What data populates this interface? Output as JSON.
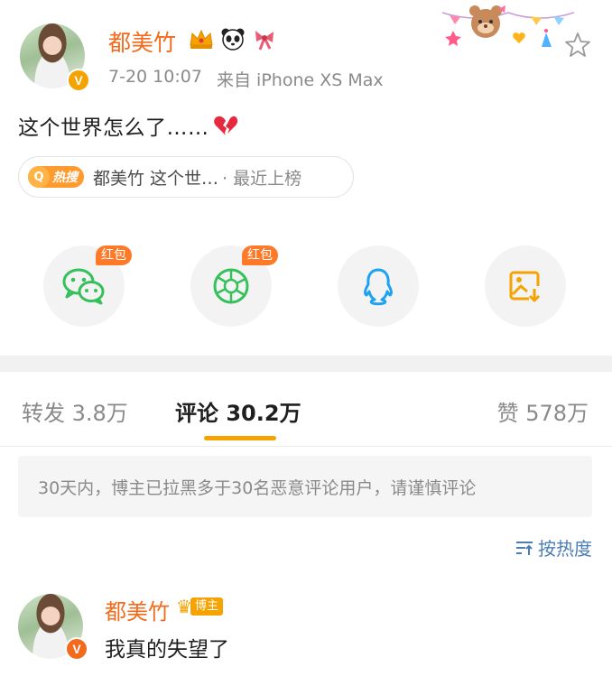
{
  "post": {
    "username": "都美竹",
    "timestamp": "7-20 10:07",
    "source": "来自 iPhone XS Max",
    "text": "这个世界怎么了……",
    "verified_mark": "V"
  },
  "hot_search": {
    "badge": "热搜",
    "badge_icon": "Q",
    "title": "都美竹 这个世…",
    "suffix": "· 最近上榜"
  },
  "share": {
    "items": [
      {
        "icon": "wechat-icon",
        "badge": "红包",
        "color": "#35c05b"
      },
      {
        "icon": "moments-icon",
        "badge": "红包",
        "color": "#35c05b"
      },
      {
        "icon": "qq-icon",
        "color": "#1da1f2"
      },
      {
        "icon": "save-image-icon",
        "color": "#f5a300"
      }
    ]
  },
  "tabs": {
    "repost": "转发 3.8万",
    "comment": "评论 30.2万",
    "like": "赞 578万"
  },
  "notice": "30天内，博主已拉黑多于30名恶意评论用户，请谨慎评论",
  "sort": {
    "icon": "sort-icon",
    "label": "按热度"
  },
  "comment": {
    "username": "都美竹",
    "badge": "博主",
    "text": "我真的失望了",
    "verified_mark": "V"
  },
  "colors": {
    "username": "#f26b1d",
    "accent": "#f5a300",
    "link": "#4b7eb7",
    "redpack": "#ff7a28"
  }
}
